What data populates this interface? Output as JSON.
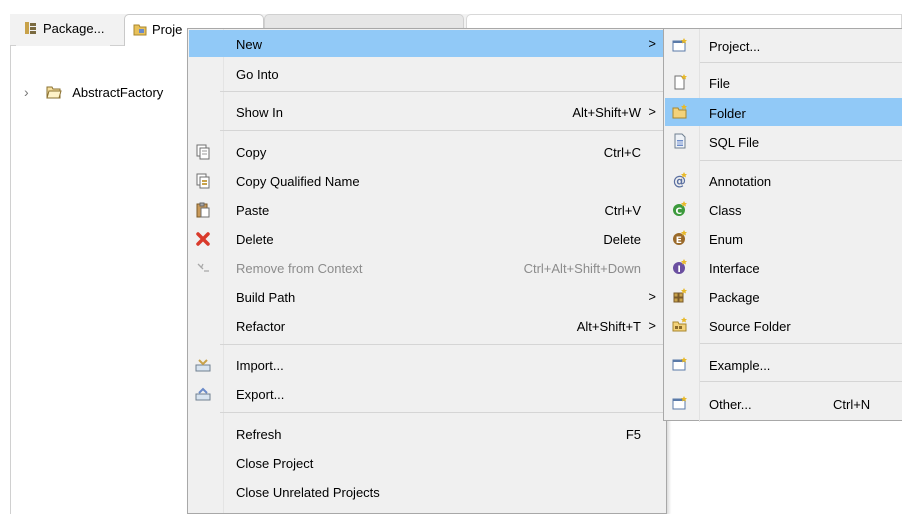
{
  "tabs": [
    {
      "label": "Package..."
    },
    {
      "label": "Proje"
    }
  ],
  "tree": {
    "project_label": "AbstractFactory"
  },
  "context_menu": {
    "items": [
      {
        "label": "New",
        "shortcut": "",
        "submenu": true
      },
      {
        "label": "Go Into",
        "shortcut": ""
      },
      {
        "label": "Show In",
        "shortcut": "Alt+Shift+W",
        "submenu": true
      },
      {
        "label": "Copy",
        "shortcut": "Ctrl+C"
      },
      {
        "label": "Copy Qualified Name",
        "shortcut": ""
      },
      {
        "label": "Paste",
        "shortcut": "Ctrl+V"
      },
      {
        "label": "Delete",
        "shortcut": "Delete"
      },
      {
        "label": "Remove from Context",
        "shortcut": "Ctrl+Alt+Shift+Down",
        "disabled": true
      },
      {
        "label": "Build Path",
        "shortcut": "",
        "submenu": true
      },
      {
        "label": "Refactor",
        "shortcut": "Alt+Shift+T",
        "submenu": true
      },
      {
        "label": "Import...",
        "shortcut": ""
      },
      {
        "label": "Export...",
        "shortcut": ""
      },
      {
        "label": "Refresh",
        "shortcut": "F5"
      },
      {
        "label": "Close Project",
        "shortcut": ""
      },
      {
        "label": "Close Unrelated Projects",
        "shortcut": ""
      }
    ],
    "arrow_glyph": ">"
  },
  "new_submenu": {
    "items": [
      {
        "label": "Project...",
        "shortcut": ""
      },
      {
        "label": "File",
        "shortcut": ""
      },
      {
        "label": "Folder",
        "shortcut": ""
      },
      {
        "label": "SQL File",
        "shortcut": ""
      },
      {
        "label": "Annotation",
        "shortcut": ""
      },
      {
        "label": "Class",
        "shortcut": ""
      },
      {
        "label": "Enum",
        "shortcut": ""
      },
      {
        "label": "Interface",
        "shortcut": ""
      },
      {
        "label": "Package",
        "shortcut": ""
      },
      {
        "label": "Source Folder",
        "shortcut": ""
      },
      {
        "label": "Example...",
        "shortcut": ""
      },
      {
        "label": "Other...",
        "shortcut": "Ctrl+N"
      }
    ]
  },
  "colors": {
    "highlight": "#91c9f7",
    "menu_bg": "#f0f0f0",
    "disabled_text": "#8c8c8c"
  }
}
